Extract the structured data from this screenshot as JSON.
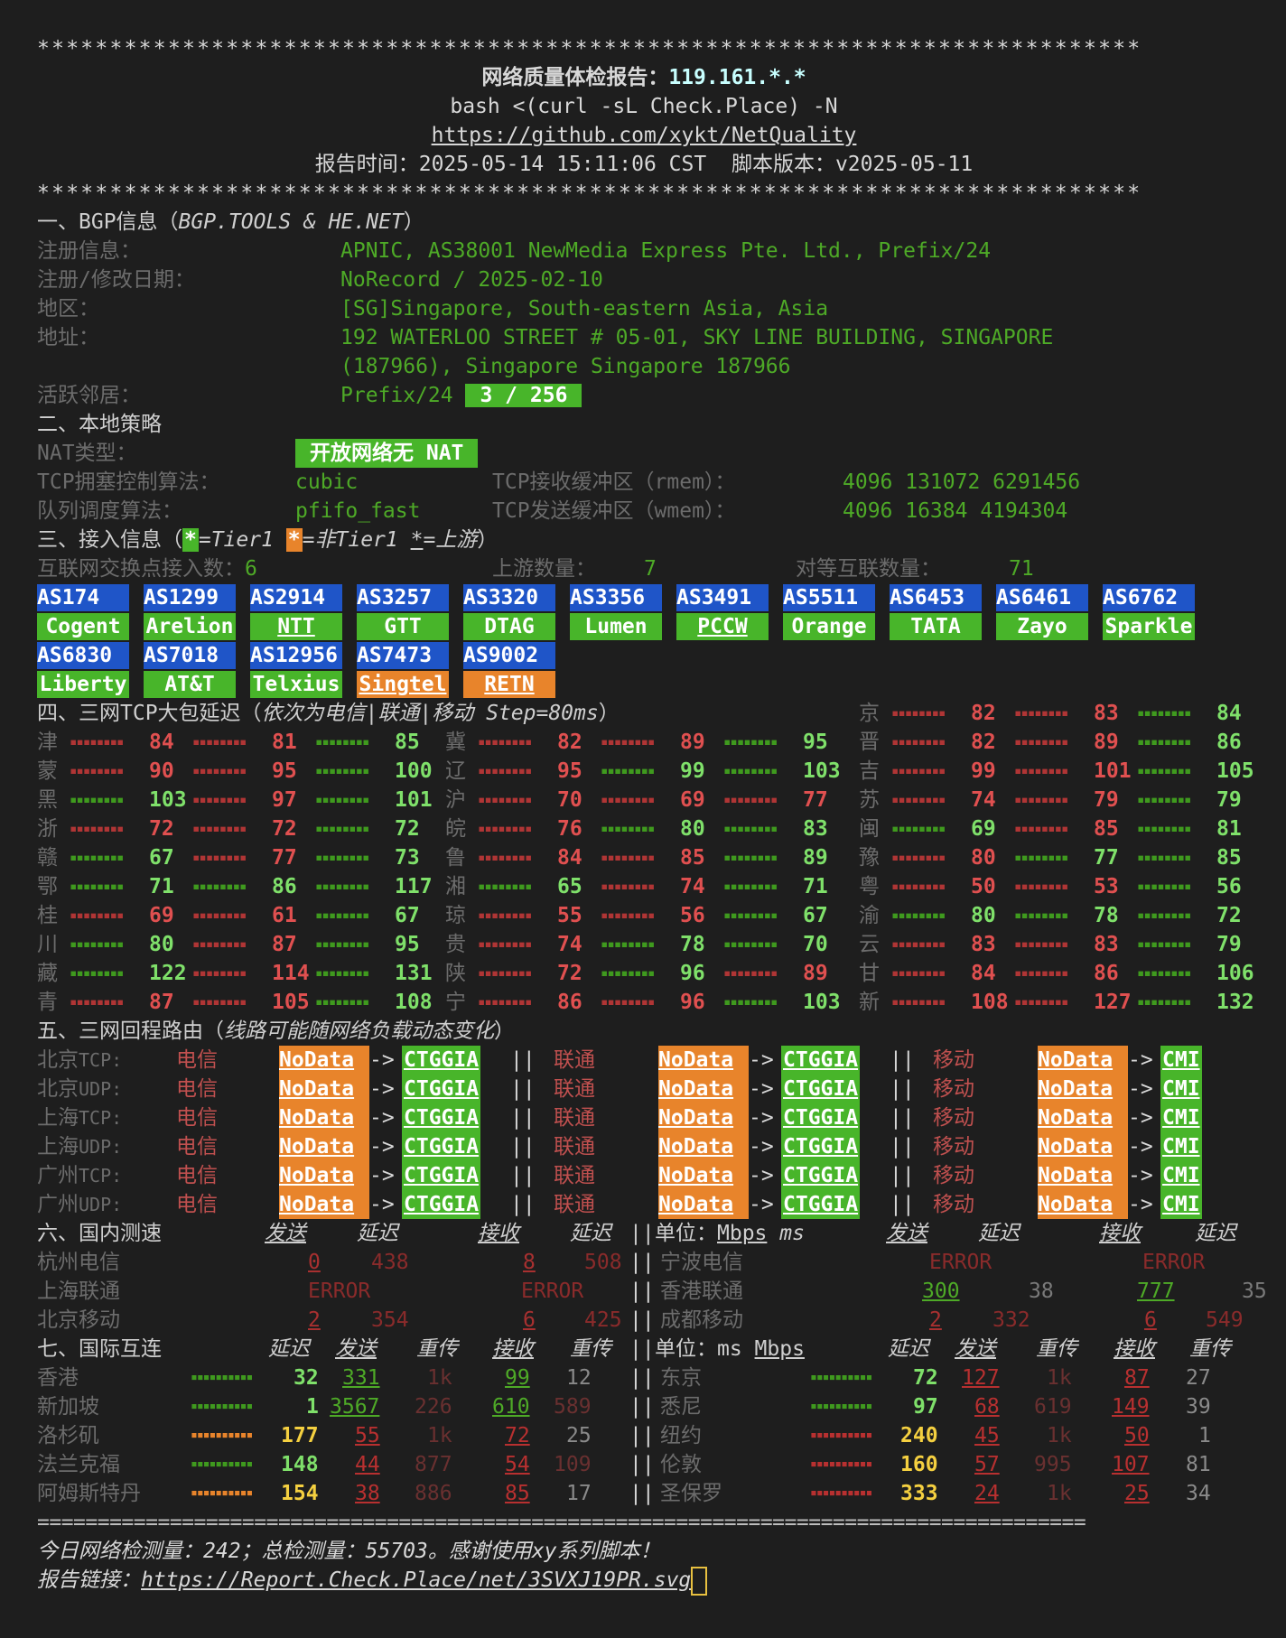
{
  "header": {
    "stars": "****************************************************************************",
    "title_label": "网络质量体检报告：",
    "ip": "119.161.*.*",
    "command": "bash <(curl -sL Check.Place) -N",
    "repo": "https://github.com/xykt/NetQuality",
    "report_time_label": "报告时间：",
    "report_time": "2025-05-14 15:11:06 CST",
    "version_label": "脚本版本：",
    "version": "v2025-05-11"
  },
  "bgp": {
    "title": "一、BGP信息（",
    "source": "BGP.TOOLS & HE.NET",
    "close": "）",
    "reg_label": "注册信息：",
    "reg": "APNIC, AS38001 NewMedia Express Pte. Ltd., Prefix/24",
    "date_label": "注册/修改日期：",
    "date": "NoRecord / 2025-02-10",
    "region_label": "地区：",
    "region": "[SG]Singapore, South-eastern Asia, Asia",
    "addr_label": "地址：",
    "addr1": "192 WATERLOO STREET # 05-01, SKY LINE BUILDING, SINGAPORE",
    "addr2": "(187966), Singapore Singapore 187966",
    "neighbor_label": "活跃邻居：",
    "neighbor_prefix": "Prefix/24",
    "neighbor_count": "3 / 256"
  },
  "policy": {
    "title": "二、本地策略",
    "nat_label": "NAT类型：",
    "nat": "开放网络无 NAT",
    "tcp_cc_label": "TCP拥塞控制算法：",
    "tcp_cc": "cubic",
    "rmem_label": "TCP接收缓冲区（rmem）：",
    "rmem": "4096 131072 6291456",
    "qdisc_label": "队列调度算法：",
    "qdisc": "pfifo_fast",
    "wmem_label": "TCP发送缓冲区（wmem）：",
    "wmem": "4096 16384 4194304"
  },
  "access": {
    "title": "三、接入信息（",
    "legend_t1": "=Tier1 ",
    "legend_nt1": "=非Tier1 ",
    "legend_up": "=上游",
    "legend_close": "）",
    "ix_label": "互联网交换点接入数：",
    "ix": "6",
    "up_label": "上游数量：",
    "up": "7",
    "peer_label": "对等互联数量：",
    "peer": "71",
    "as_row1": [
      {
        "as": "AS174",
        "name": "Cogent",
        "t": "g"
      },
      {
        "as": "AS1299",
        "name": "Arelion",
        "t": "g"
      },
      {
        "as": "AS2914",
        "name": "NTT",
        "t": "gu"
      },
      {
        "as": "AS3257",
        "name": "GTT",
        "t": "g"
      },
      {
        "as": "AS3320",
        "name": "DTAG",
        "t": "g"
      },
      {
        "as": "AS3356",
        "name": "Lumen",
        "t": "g"
      },
      {
        "as": "AS3491",
        "name": "PCCW",
        "t": "gu"
      },
      {
        "as": "AS5511",
        "name": "Orange",
        "t": "g"
      },
      {
        "as": "AS6453",
        "name": "TATA",
        "t": "g"
      },
      {
        "as": "AS6461",
        "name": "Zayo",
        "t": "g"
      },
      {
        "as": "AS6762",
        "name": "Sparkle",
        "t": "g"
      }
    ],
    "as_row2": [
      {
        "as": "AS6830",
        "name": "Liberty",
        "t": "g"
      },
      {
        "as": "AS7018",
        "name": "AT&T",
        "t": "g"
      },
      {
        "as": "AS12956",
        "name": "Telxius",
        "t": "g"
      },
      {
        "as": "AS7473",
        "name": "Singtel",
        "t": "ou"
      },
      {
        "as": "AS9002",
        "name": "RETN",
        "t": "ou"
      }
    ]
  },
  "latency": {
    "title": "四、三网TCP大包延迟（",
    "title_it": "依次为电信|联通|移动",
    "step": " Step=80ms",
    "close": "）",
    "rows": [
      [
        null,
        null,
        null,
        {
          "p": "京",
          "v": [
            "82",
            "83",
            "84"
          ],
          "c": [
            "r",
            "r",
            "g"
          ]
        }
      ],
      [
        {
          "p": "津",
          "v": [
            "84",
            "81",
            "85"
          ],
          "c": [
            "r",
            "r",
            "g"
          ]
        },
        null,
        {
          "p": "冀",
          "v": [
            "82",
            "89",
            "95"
          ],
          "c": [
            "r",
            "r",
            "g"
          ]
        },
        {
          "p": "晋",
          "v": [
            "82",
            "89",
            "86"
          ],
          "c": [
            "r",
            "r",
            "g"
          ]
        }
      ],
      [
        {
          "p": "蒙",
          "v": [
            "90",
            "95",
            "100"
          ],
          "c": [
            "r",
            "r",
            "g"
          ]
        },
        null,
        {
          "p": "辽",
          "v": [
            "95",
            "99",
            "103"
          ],
          "c": [
            "r",
            "g",
            "g"
          ]
        },
        {
          "p": "吉",
          "v": [
            "99",
            "101",
            "105"
          ],
          "c": [
            "r",
            "r",
            "g"
          ]
        }
      ],
      [
        {
          "p": "黑",
          "v": [
            "103",
            "97",
            "101"
          ],
          "c": [
            "g",
            "r",
            "g"
          ]
        },
        null,
        {
          "p": "沪",
          "v": [
            "70",
            "69",
            "77"
          ],
          "c": [
            "r",
            "r",
            "r"
          ]
        },
        {
          "p": "苏",
          "v": [
            "74",
            "79",
            "79"
          ],
          "c": [
            "r",
            "r",
            "g"
          ]
        }
      ],
      [
        {
          "p": "浙",
          "v": [
            "72",
            "72",
            "72"
          ],
          "c": [
            "r",
            "r",
            "g"
          ]
        },
        null,
        {
          "p": "皖",
          "v": [
            "76",
            "80",
            "83"
          ],
          "c": [
            "r",
            "g",
            "g"
          ]
        },
        {
          "p": "闽",
          "v": [
            "69",
            "85",
            "81"
          ],
          "c": [
            "g",
            "r",
            "g"
          ]
        }
      ],
      [
        {
          "p": "赣",
          "v": [
            "67",
            "77",
            "73"
          ],
          "c": [
            "g",
            "r",
            "g"
          ]
        },
        null,
        {
          "p": "鲁",
          "v": [
            "84",
            "85",
            "89"
          ],
          "c": [
            "r",
            "r",
            "g"
          ]
        },
        {
          "p": "豫",
          "v": [
            "80",
            "77",
            "85"
          ],
          "c": [
            "r",
            "g",
            "g"
          ]
        }
      ],
      [
        {
          "p": "鄂",
          "v": [
            "71",
            "86",
            "117"
          ],
          "c": [
            "g",
            "g",
            "g"
          ]
        },
        null,
        {
          "p": "湘",
          "v": [
            "65",
            "74",
            "71"
          ],
          "c": [
            "g",
            "r",
            "g"
          ]
        },
        {
          "p": "粤",
          "v": [
            "50",
            "53",
            "56"
          ],
          "c": [
            "r",
            "r",
            "g"
          ]
        }
      ],
      [
        {
          "p": "桂",
          "v": [
            "69",
            "61",
            "67"
          ],
          "c": [
            "r",
            "r",
            "g"
          ]
        },
        null,
        {
          "p": "琼",
          "v": [
            "55",
            "56",
            "67"
          ],
          "c": [
            "r",
            "r",
            "g"
          ]
        },
        {
          "p": "渝",
          "v": [
            "80",
            "78",
            "72"
          ],
          "c": [
            "g",
            "g",
            "g"
          ]
        }
      ],
      [
        {
          "p": "川",
          "v": [
            "80",
            "87",
            "95"
          ],
          "c": [
            "g",
            "r",
            "g"
          ]
        },
        null,
        {
          "p": "贵",
          "v": [
            "74",
            "78",
            "70"
          ],
          "c": [
            "r",
            "g",
            "g"
          ]
        },
        {
          "p": "云",
          "v": [
            "83",
            "83",
            "79"
          ],
          "c": [
            "r",
            "r",
            "g"
          ]
        }
      ],
      [
        {
          "p": "藏",
          "v": [
            "122",
            "114",
            "131"
          ],
          "c": [
            "g",
            "r",
            "g"
          ]
        },
        null,
        {
          "p": "陕",
          "v": [
            "72",
            "96",
            "89"
          ],
          "c": [
            "r",
            "g",
            "r"
          ]
        },
        {
          "p": "甘",
          "v": [
            "84",
            "86",
            "106"
          ],
          "c": [
            "r",
            "r",
            "g"
          ]
        }
      ],
      [
        {
          "p": "青",
          "v": [
            "87",
            "105",
            "108"
          ],
          "c": [
            "r",
            "r",
            "g"
          ]
        },
        null,
        {
          "p": "宁",
          "v": [
            "86",
            "96",
            "103"
          ],
          "c": [
            "r",
            "r",
            "g"
          ]
        },
        {
          "p": "新",
          "v": [
            "108",
            "127",
            "132"
          ],
          "c": [
            "r",
            "r",
            "g"
          ]
        }
      ]
    ]
  },
  "route": {
    "title": "五、三网回程路由（",
    "title_it": "线路可能随网络负载动态变化",
    "close": "）",
    "tel": "电信",
    "uni": "联通",
    "mob": "移动",
    "nodata": "NoData",
    "arrow": "->",
    "ctg": "CTGGIA",
    "cmi": "CMI",
    "sep": "||",
    "rows": [
      {
        "city": "北京",
        "proto": "TCP:"
      },
      {
        "city": "北京",
        "proto": "UDP:"
      },
      {
        "city": "上海",
        "proto": "TCP:"
      },
      {
        "city": "上海",
        "proto": "UDP:"
      },
      {
        "city": "广州",
        "proto": "TCP:"
      },
      {
        "city": "广州",
        "proto": "UDP:"
      }
    ]
  },
  "domestic": {
    "title": "六、国内测速",
    "h_send": "发送",
    "h_lat": "延迟",
    "h_recv": "接收",
    "h_lat2": "延迟",
    "unit": "单位：",
    "unit_mbps": "Mbps",
    "unit_ms": " ms",
    "sep": "||",
    "left": [
      {
        "n": "杭州电信",
        "s": "0",
        "l1": "438",
        "r": "8",
        "l2": "508"
      },
      {
        "n": "上海联通",
        "err1": "ERROR",
        "err2": "ERROR"
      },
      {
        "n": "北京移动",
        "s": "2",
        "l1": "354",
        "r": "6",
        "l2": "425"
      }
    ],
    "right": [
      {
        "n": "宁波电信",
        "err1": "ERROR",
        "err2": "ERROR"
      },
      {
        "n": "香港联通",
        "s": "300",
        "l1": "38",
        "r": "777",
        "l2": "35"
      },
      {
        "n": "成都移动",
        "s": "2",
        "l1": "332",
        "r": "6",
        "l2": "549"
      }
    ]
  },
  "intl": {
    "title": "七、国际互连",
    "h_lat": "延迟",
    "h_send": "发送",
    "h_re": "重传",
    "h_recv": "接收",
    "h_re2": "重传",
    "unit": "单位：",
    "unit_ms": "ms ",
    "unit_mbps": "Mbps",
    "sep": "||",
    "left": [
      {
        "n": "香港",
        "lat": "32",
        "s": "331",
        "re": "1k",
        "r": "99",
        "re2": "12",
        "c": "g"
      },
      {
        "n": "新加坡",
        "lat": "1",
        "s": "3567",
        "re": "226",
        "r": "610",
        "re2": "589",
        "c": "g"
      },
      {
        "n": "洛杉矶",
        "lat": "177",
        "s": "55",
        "re": "1k",
        "r": "72",
        "re2": "25",
        "c": "y"
      },
      {
        "n": "法兰克福",
        "lat": "148",
        "s": "44",
        "re": "877",
        "r": "54",
        "re2": "109",
        "c": "g"
      },
      {
        "n": "阿姆斯特丹",
        "lat": "154",
        "s": "38",
        "re": "886",
        "r": "85",
        "re2": "17",
        "c": "y"
      }
    ],
    "right": [
      {
        "n": "东京",
        "lat": "72",
        "s": "127",
        "re": "1k",
        "r": "87",
        "re2": "27",
        "c": "g"
      },
      {
        "n": "悉尼",
        "lat": "97",
        "s": "68",
        "re": "619",
        "r": "149",
        "re2": "39",
        "c": "g"
      },
      {
        "n": "纽约",
        "lat": "240",
        "s": "45",
        "re": "1k",
        "r": "50",
        "re2": "1",
        "c": "y"
      },
      {
        "n": "伦敦",
        "lat": "160",
        "s": "57",
        "re": "995",
        "r": "107",
        "re2": "81",
        "c": "y"
      },
      {
        "n": "圣保罗",
        "lat": "333",
        "s": "24",
        "re": "1k",
        "r": "25",
        "re2": "34",
        "c": "y"
      }
    ]
  },
  "footer": {
    "rule": "=======================================================================================",
    "count_text": "今日网络检测量：242；总检测量：55703。感谢使用xy系列脚本！",
    "link_label": "报告链接：",
    "link": "https://Report.Check.Place/net/3SVXJ19PR.svg"
  },
  "colors": {
    "bg": "#1e1e1e",
    "green": "#4eaa27",
    "red": "#e05050",
    "orange": "#e8842b",
    "blue": "#1f55c8",
    "cyan": "#c8ffff"
  }
}
